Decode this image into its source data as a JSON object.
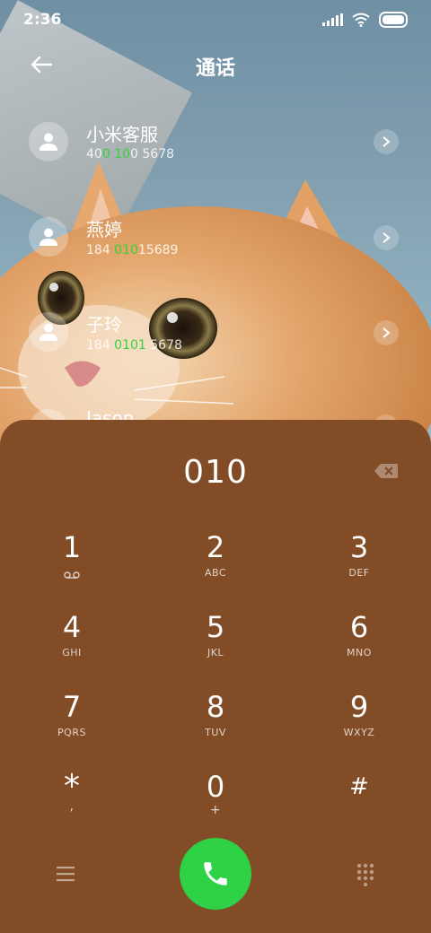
{
  "status_bar": {
    "time": "2:36"
  },
  "header": {
    "title": "通话"
  },
  "contacts": [
    {
      "name": "小米客服",
      "number_parts": [
        "40",
        "0",
        " ",
        "10",
        "0 5678"
      ]
    },
    {
      "name": "燕婷",
      "number_parts": [
        "184 ",
        "010",
        "15689"
      ]
    },
    {
      "name": "子玲",
      "number_parts": [
        "184 ",
        "0101",
        " 5678"
      ]
    },
    {
      "name": "Jason"
    }
  ],
  "dialpad": {
    "input": "010",
    "keys": [
      {
        "digit": "1",
        "sub": "⌁"
      },
      {
        "digit": "2",
        "sub": "ABC"
      },
      {
        "digit": "3",
        "sub": "DEF"
      },
      {
        "digit": "4",
        "sub": "GHI"
      },
      {
        "digit": "5",
        "sub": "JKL"
      },
      {
        "digit": "6",
        "sub": "MNO"
      },
      {
        "digit": "7",
        "sub": "PQRS"
      },
      {
        "digit": "8",
        "sub": "TUV"
      },
      {
        "digit": "9",
        "sub": "WXYZ"
      },
      {
        "digit": "*",
        "sub": ","
      },
      {
        "digit": "0",
        "sub": "+"
      },
      {
        "digit": "#",
        "sub": ""
      }
    ]
  },
  "colors": {
    "pad_bg": "#824c26",
    "call_green": "#2fd146",
    "highlight_green": "#34d23e"
  },
  "icons": {
    "back": "arrow-left-icon",
    "chevron": "chevron-right-icon",
    "backspace": "backspace-icon",
    "menu": "menu-icon",
    "call": "phone-icon",
    "keypad": "dialpad-icon"
  }
}
